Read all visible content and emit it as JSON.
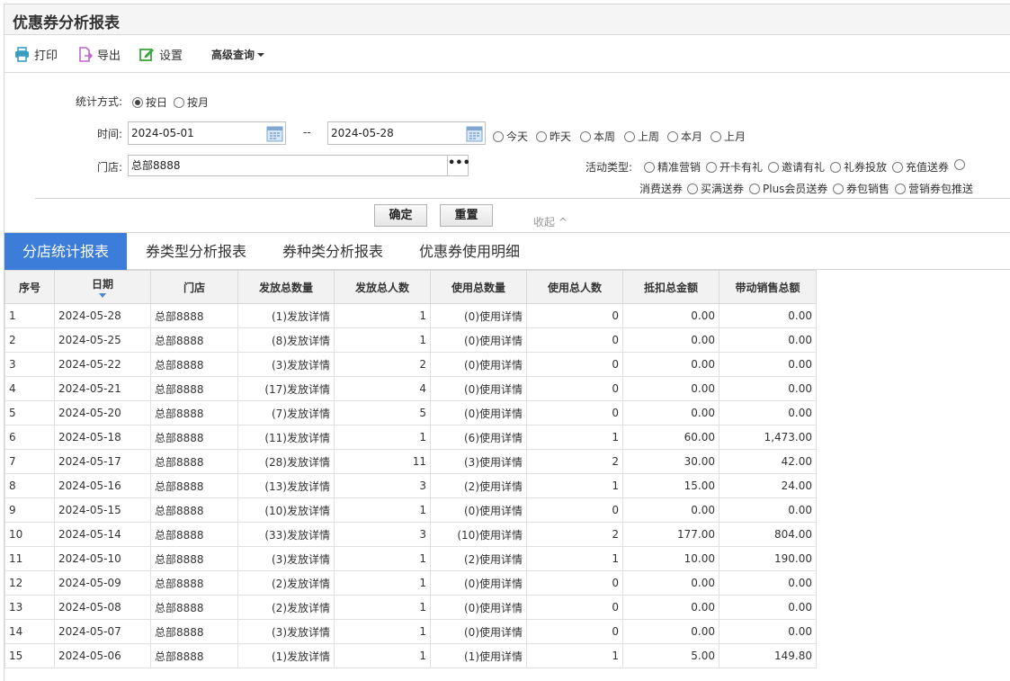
{
  "page_title": "优惠券分析报表",
  "toolbar": {
    "print": "打印",
    "export": "导出",
    "settings": "设置",
    "advanced": "高级查询"
  },
  "filters": {
    "stat_method_label": "统计方式:",
    "by_day": "按日",
    "by_month": "按月",
    "stat_method_selected": "按日",
    "time_label": "时间:",
    "date_from": "2024-05-01",
    "date_sep": "--",
    "date_to": "2024-05-28",
    "quick_ranges": [
      "今天",
      "昨天",
      "本周",
      "上周",
      "本月",
      "上月"
    ],
    "store_label": "门店:",
    "store_value": "总部8888",
    "store_more": "•••",
    "activity_label": "活动类型:",
    "activity_types": [
      "精准营销",
      "开卡有礼",
      "邀请有礼",
      "礼券投放",
      "充值送券",
      "消费送券",
      "买满送券",
      "Plus会员送券",
      "券包销售",
      "营销券包推送"
    ]
  },
  "actions": {
    "confirm": "确定",
    "reset": "重置",
    "collapse": "收起 ^"
  },
  "tabs": [
    "分店统计报表",
    "券类型分析报表",
    "券种类分析报表",
    "优惠券使用明细"
  ],
  "active_tab": 0,
  "table": {
    "columns": [
      "序号",
      "日期",
      "门店",
      "发放总数量",
      "发放总人数",
      "使用总数量",
      "使用总人数",
      "抵扣总金额",
      "带动销售总额"
    ],
    "rows": [
      [
        "1",
        "2024-05-28",
        "总部8888",
        "(1)发放详情",
        "1",
        "(0)使用详情",
        "0",
        "0.00",
        "0.00"
      ],
      [
        "2",
        "2024-05-25",
        "总部8888",
        "(8)发放详情",
        "1",
        "(0)使用详情",
        "0",
        "0.00",
        "0.00"
      ],
      [
        "3",
        "2024-05-22",
        "总部8888",
        "(3)发放详情",
        "2",
        "(0)使用详情",
        "0",
        "0.00",
        "0.00"
      ],
      [
        "4",
        "2024-05-21",
        "总部8888",
        "(17)发放详情",
        "4",
        "(0)使用详情",
        "0",
        "0.00",
        "0.00"
      ],
      [
        "5",
        "2024-05-20",
        "总部8888",
        "(7)发放详情",
        "5",
        "(0)使用详情",
        "0",
        "0.00",
        "0.00"
      ],
      [
        "6",
        "2024-05-18",
        "总部8888",
        "(11)发放详情",
        "1",
        "(6)使用详情",
        "1",
        "60.00",
        "1,473.00"
      ],
      [
        "7",
        "2024-05-17",
        "总部8888",
        "(28)发放详情",
        "11",
        "(3)使用详情",
        "2",
        "30.00",
        "42.00"
      ],
      [
        "8",
        "2024-05-16",
        "总部8888",
        "(13)发放详情",
        "3",
        "(2)使用详情",
        "1",
        "15.00",
        "24.00"
      ],
      [
        "9",
        "2024-05-15",
        "总部8888",
        "(10)发放详情",
        "1",
        "(0)使用详情",
        "0",
        "0.00",
        "0.00"
      ],
      [
        "10",
        "2024-05-14",
        "总部8888",
        "(33)发放详情",
        "3",
        "(10)使用详情",
        "2",
        "177.00",
        "804.00"
      ],
      [
        "11",
        "2024-05-10",
        "总部8888",
        "(3)发放详情",
        "1",
        "(2)使用详情",
        "1",
        "10.00",
        "190.00"
      ],
      [
        "12",
        "2024-05-09",
        "总部8888",
        "(2)发放详情",
        "1",
        "(0)使用详情",
        "0",
        "0.00",
        "0.00"
      ],
      [
        "13",
        "2024-05-08",
        "总部8888",
        "(2)发放详情",
        "1",
        "(0)使用详情",
        "0",
        "0.00",
        "0.00"
      ],
      [
        "14",
        "2024-05-07",
        "总部8888",
        "(3)发放详情",
        "1",
        "(0)使用详情",
        "0",
        "0.00",
        "0.00"
      ],
      [
        "15",
        "2024-05-06",
        "总部8888",
        "(1)发放详情",
        "1",
        "(1)使用详情",
        "1",
        "5.00",
        "149.80"
      ]
    ]
  },
  "colors": {
    "accent": "#3b7dd8",
    "link": "#2a6bbf",
    "print_icon": "#3a9fbf",
    "export_icon": "#c065c8",
    "settings_icon": "#3aa53a"
  },
  "icons": {
    "print": "printer-icon",
    "export": "export-file-icon",
    "settings": "edit-settings-icon",
    "calendar": "calendar-icon",
    "sort": "sort-desc-icon"
  }
}
